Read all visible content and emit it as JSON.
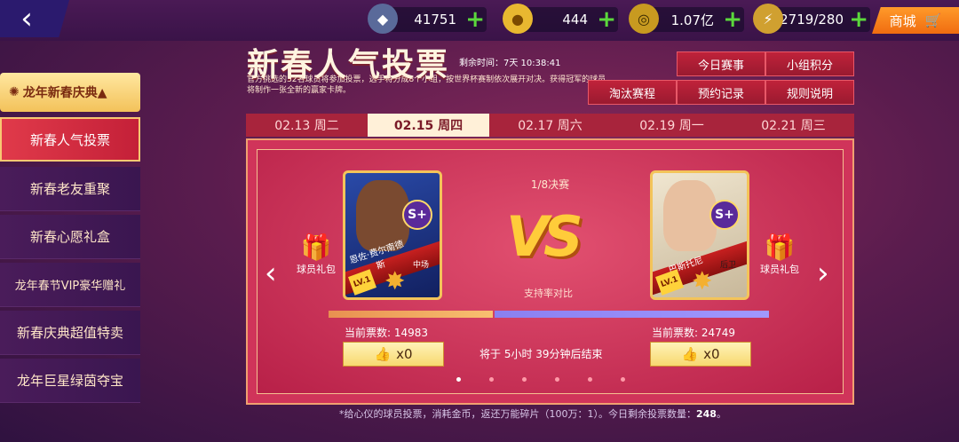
{
  "resources": [
    {
      "icon": "diamond-icon",
      "value": "41751"
    },
    {
      "icon": "gold-coin-icon",
      "value": "444"
    },
    {
      "icon": "currency-coin-icon",
      "value": "1.07亿"
    },
    {
      "icon": "energy-icon",
      "value": "2719/280"
    }
  ],
  "shop_label": "商城",
  "sidebar": {
    "header": "龙年新春庆典▲",
    "items": [
      "新春人气投票",
      "新春老友重聚",
      "新春心愿礼盒",
      "龙年春节VIP豪华赠礼",
      "新春庆典超值特卖",
      "龙年巨星绿茵夺宝"
    ]
  },
  "event": {
    "title": "新春人气投票",
    "timer_label": "剩余时间：7天 10:38:41",
    "description": "官方挑选的32名球员将参加投票，选手将分成8个小组，按世界杯赛制依次展开对决。获得冠军的球员将制作一张全新的赢家卡牌。"
  },
  "top_buttons": [
    "今日赛事",
    "小组积分",
    "淘汰赛程",
    "预约记录",
    "规则说明"
  ],
  "dates": [
    "02.13 周二",
    "02.15 周四",
    "02.17 周六",
    "02.19 周一",
    "02.21 周三"
  ],
  "active_date_index": 1,
  "match": {
    "round": "1/8决赛",
    "vs": "VS",
    "support_label": "支持率对比",
    "gift_label": "球员礼包",
    "end_text": "将于 5小时 39分钟后结束",
    "player1": {
      "name": "恩佐·费尔南德斯",
      "position": "中场",
      "grade": "S+",
      "level": "LV.1",
      "votes_label": "当前票数: 14983",
      "votes": 14983,
      "likes": "x0"
    },
    "player2": {
      "name": "巴斯托尼",
      "position": "后卫",
      "grade": "S+",
      "level": "LV.1",
      "votes_label": "当前票数: 24749",
      "votes": 24749,
      "likes": "x0"
    }
  },
  "pagination": {
    "count": 6,
    "active": 0
  },
  "footer": {
    "text": "*给心仪的球员投票，消耗金币，返还万能碎片（100万：1）。今日剩余投票数量：",
    "remaining": "248",
    "end": "。"
  },
  "colors": {
    "accent": "#d0345a",
    "gold": "#ffcc3a",
    "plus": "#5bd83c"
  }
}
